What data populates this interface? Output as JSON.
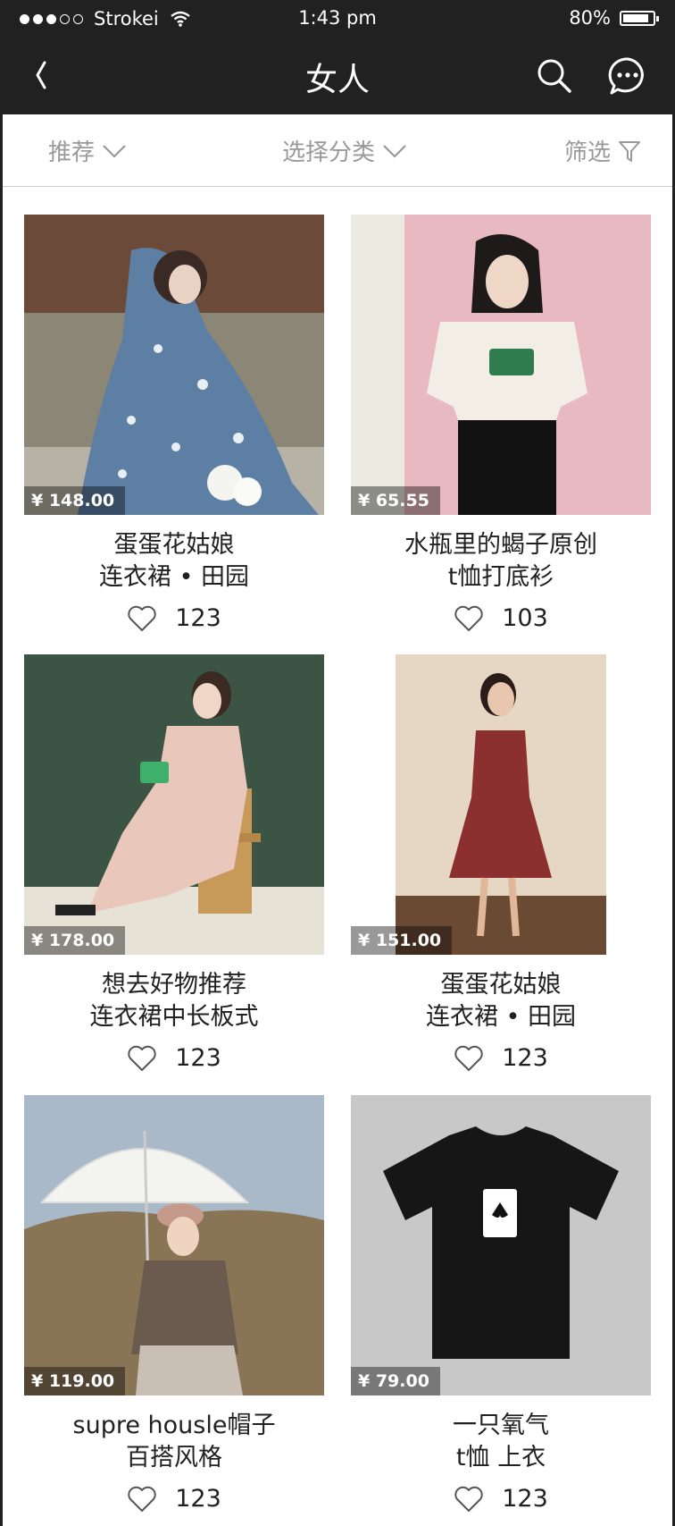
{
  "status_bar": {
    "carrier": "Strokei",
    "time": "1:43 pm",
    "battery": "80%"
  },
  "nav": {
    "title": "女人"
  },
  "filters": {
    "sort": "推荐",
    "category": "选择分类",
    "filter": "筛选"
  },
  "products": [
    {
      "price": "¥ 148.00",
      "title1": "蛋蛋花姑娘",
      "title2": "连衣裙 • 田园",
      "likes": "123"
    },
    {
      "price": "¥ 65.55",
      "title1": "水瓶里的蝎子原创",
      "title2": "t恤打底衫",
      "likes": "103"
    },
    {
      "price": "¥ 178.00",
      "title1": "想去好物推荐",
      "title2": "连衣裙中长板式",
      "likes": "123"
    },
    {
      "price": "¥ 151.00",
      "title1": "蛋蛋花姑娘",
      "title2": "连衣裙 • 田园",
      "likes": "123"
    },
    {
      "price": "¥ 119.00",
      "title1": "supre housle帽子",
      "title2": "百搭风格",
      "likes": "123"
    },
    {
      "price": "¥ 79.00",
      "title1": "一只氧气",
      "title2": "t恤 上衣",
      "likes": "123"
    }
  ],
  "colors": {
    "nav_bg": "#212121",
    "nav_text": "#ffffff",
    "filter_text": "#999999",
    "divider": "#cccccc",
    "price_overlay": "#000000"
  },
  "icons": [
    "back-icon",
    "search-icon",
    "message-icon",
    "chevron-down-icon",
    "filter-icon",
    "heart-icon",
    "wifi-icon",
    "battery-icon"
  ]
}
